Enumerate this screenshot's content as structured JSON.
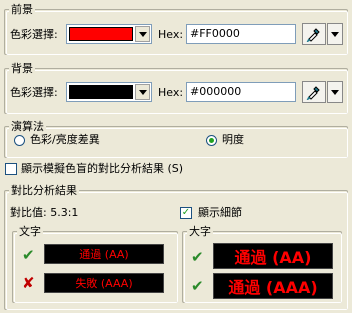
{
  "foreground": {
    "title": "前景",
    "color_label": "色彩選擇:",
    "color": "#FF0000",
    "hex_label": "Hex:",
    "hex_value": "#FF0000"
  },
  "background": {
    "title": "背景",
    "color_label": "色彩選擇:",
    "color": "#000000",
    "hex_label": "Hex:",
    "hex_value": "#000000"
  },
  "algorithm": {
    "title": "演算法",
    "option_color_brightness": "色彩/亮度差異",
    "option_luminosity": "明度",
    "selected": "luminosity"
  },
  "color_blind": {
    "label": "顯示模擬色盲的對比分析結果 (S)",
    "checked": false
  },
  "results": {
    "title": "對比分析結果",
    "contrast_label": "對比值: 5.3:1",
    "show_details_label": "顯示細節",
    "show_details_checked": true,
    "text_group": {
      "title": "文字",
      "pass_aa": "通過 (AA)",
      "fail_aaa": "失敗 (AAA)"
    },
    "large_text_group": {
      "title": "大字",
      "pass_aa": "通過 (AA)",
      "pass_aaa": "通過 (AAA)"
    },
    "mark_pass": "✔",
    "mark_fail": "✘"
  },
  "colors": {
    "result_text": "#FF0000",
    "result_bg": "#000000",
    "pass": "#2A8A2A",
    "fail": "#C00000"
  },
  "icons": {
    "picker": "eyedropper-icon",
    "dropdown": "chevron-down-icon"
  }
}
